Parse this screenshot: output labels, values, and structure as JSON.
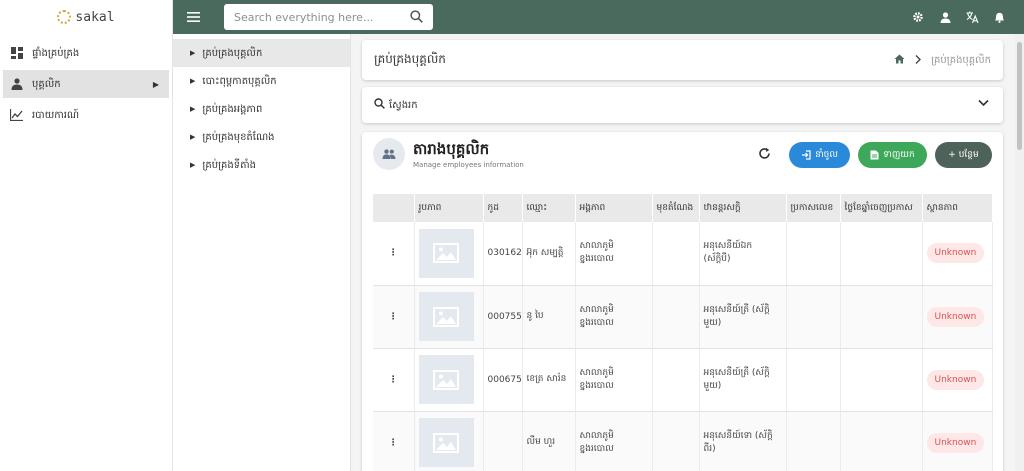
{
  "app": {
    "logo_text": "sakal"
  },
  "sidebar": {
    "items": [
      {
        "label": "ផ្ទាំងគ្រប់គ្រង",
        "icon": "dashboard-icon"
      },
      {
        "label": "បុគ្គលិក",
        "icon": "people-icon",
        "active": true
      },
      {
        "label": "របាយការណ៍",
        "icon": "chart-icon"
      }
    ]
  },
  "topbar": {
    "search_placeholder": "Search everything here...",
    "icons": [
      "gear-icon",
      "user-icon",
      "translate-icon",
      "bell-icon"
    ]
  },
  "submenu": {
    "items": [
      {
        "label": "គ្រប់គ្រងបុគ្គលិក",
        "active": true
      },
      {
        "label": "បោះពុម្ពកាតបុគ្គលិក"
      },
      {
        "label": "គ្រប់គ្រងអង្គភាព"
      },
      {
        "label": "គ្រប់គ្រងមុខតំណែង"
      },
      {
        "label": "គ្រប់គ្រងទីតាំង"
      }
    ]
  },
  "header": {
    "title": "គ្រប់គ្រងបុគ្គលិក",
    "breadcrumb_current": "គ្រប់គ្រងបុគ្គលិក"
  },
  "filter": {
    "label": "ស្វែងរក"
  },
  "list": {
    "title": "តារាងបុគ្គលិក",
    "subtitle": "Manage employees information",
    "import_label": "នាំចូល",
    "export_label": "ទាញយក",
    "add_label": "+ បន្ថែម",
    "columns": [
      "",
      "រូបភាព",
      "កូដ",
      "ឈ្មោះ",
      "អង្គភាព",
      "មុខតំណែង",
      "ឋានន្តរសក្តិ",
      "ប្រកាសលេខ",
      "ថ្ងៃខែឆ្នាំចេញប្រកាស",
      "ស្ថានភាព"
    ],
    "rows": [
      {
        "code": "030162",
        "name": "អ៊ុក សម្បត្តិ",
        "unit": "សាលាភូមិខ្នងរបោល",
        "position": "",
        "rank": "អនុសេនីយ៍ឯក (ស័ក្តិបី)",
        "decree": "",
        "date": "",
        "status": "Unknown"
      },
      {
        "code": "000755",
        "name": "នូ បៃ",
        "unit": "សាលាភូមិខ្នងរបោល",
        "position": "",
        "rank": "អនុសេនីយ៍ត្រី (ស័ក្តិមួយ)",
        "decree": "",
        "date": "",
        "status": "Unknown"
      },
      {
        "code": "000675",
        "name": "ខេត្រ សារ៉ន",
        "unit": "សាលាភូមិខ្នងរបោល",
        "position": "",
        "rank": "អនុសេនីយ៍ត្រី (ស័ក្តិមួយ)",
        "decree": "",
        "date": "",
        "status": "Unknown"
      },
      {
        "code": "",
        "name": "លឹម ហួរ",
        "unit": "សាលាភូមិខ្នងរបោល",
        "position": "",
        "rank": "អនុសេនីយ៍ទោ (ស័ក្តិពីរ)",
        "decree": "",
        "date": "",
        "status": "Unknown"
      }
    ]
  },
  "colors": {
    "topbar": "#4a6a5e",
    "import": "#2a8ad9",
    "export": "#3ea85a",
    "add": "#4d6259",
    "status_text": "#d95454",
    "status_bg": "#fde7e7"
  }
}
